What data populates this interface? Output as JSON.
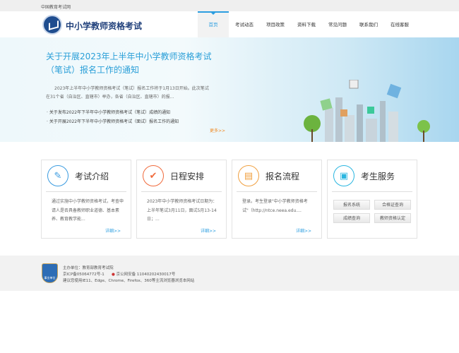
{
  "topbar": {
    "label": "中国教育考试网"
  },
  "header": {
    "title": "中小学教师资格考试",
    "nav": [
      "首页",
      "考试动态",
      "项目政策",
      "资料下载",
      "常见问题",
      "联系我们",
      "在线客服"
    ]
  },
  "banner": {
    "title": "关于开展2023年上半年中小学教师资格考试（笔试）报名工作的通知",
    "summary": "2023年上半年中小学教师资格考试（笔试）报名工作将于1月13日开始。此次笔试在31个省（自治区、直辖市）举办，各省（自治区、直辖市）的报...",
    "links": [
      "关于发布2022年下半年中小学教师资格考试（笔试）成绩的通知",
      "关于开展2022年下半年中小学教师资格考试（面试）报名工作的通知"
    ],
    "more": "更多>>"
  },
  "cards": [
    {
      "title": "考试介绍",
      "body": "通过实施中小学教师资格考试，考查申请人是否具备教师职业道德、基本素养、教育教学能...",
      "more": "详细>>",
      "color": "#3a9be0"
    },
    {
      "title": "日程安排",
      "body": "2023年中小学教师资格考试日期为：上半年笔试3月11日，面试5月13-14日；...",
      "more": "详细>>",
      "color": "#f06a3c"
    },
    {
      "title": "报名流程",
      "body": "登录。考生登录\"中小学教师资格考试\"（http://ntce.neea.edu....",
      "more": "详细>>",
      "color": "#f0a040"
    },
    {
      "title": "考生服务",
      "services": [
        "报名系统",
        "合格证查询",
        "成绩查询",
        "教师资格认定"
      ],
      "color": "#2ab6e0"
    }
  ],
  "footer": {
    "badge": "事业单位",
    "sponsor": "主办单位：教育部教育考试院",
    "icp": "京ICP备05064772号-1",
    "police": "京公网安备 11040202430017号",
    "browser": "建议您使用IE11、Edge、Chrome、Firefox、360等主流浏览器浏览本网站"
  }
}
